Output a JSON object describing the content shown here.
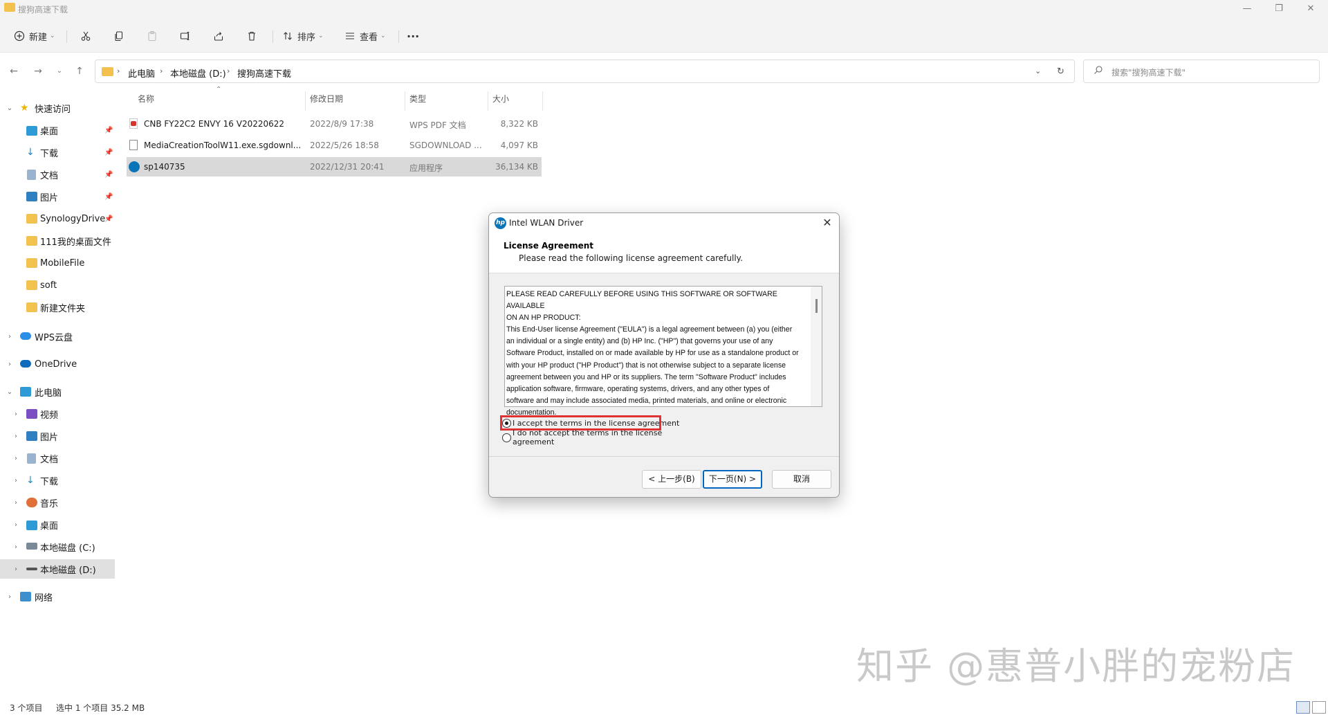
{
  "window": {
    "title": "搜狗高速下载",
    "controls": [
      "minimize-icon",
      "restore-icon",
      "close-icon"
    ]
  },
  "toolbar": {
    "new_label": "新建",
    "sort_label": "排序",
    "view_label": "查看",
    "more_label": "···"
  },
  "address": {
    "crumbs": [
      "此电脑",
      "本地磁盘 (D:)",
      "搜狗高速下载"
    ],
    "search_placeholder": "搜索\"搜狗高速下载\""
  },
  "sidebar": {
    "quick_access": "快速访问",
    "quick_items": [
      "桌面",
      "下载",
      "文档",
      "图片",
      "SynologyDrive",
      "111我的桌面文件",
      "MobileFile",
      "soft",
      "新建文件夹"
    ],
    "wps": "WPS云盘",
    "onedrive": "OneDrive",
    "this_pc": "此电脑",
    "pc_items": [
      "视频",
      "图片",
      "文档",
      "下载",
      "音乐",
      "桌面",
      "本地磁盘 (C:)",
      "本地磁盘 (D:)"
    ],
    "network": "网络"
  },
  "files": {
    "headers": [
      "名称",
      "修改日期",
      "类型",
      "大小"
    ],
    "rows": [
      {
        "name": "CNB FY22C2  ENVY 16 V20220622",
        "date": "2022/8/9 17:38",
        "type": "WPS PDF 文档",
        "size": "8,322 KB",
        "icon": "pdf-icon"
      },
      {
        "name": "MediaCreationToolW11.exe.sgdownl...",
        "date": "2022/5/26 18:58",
        "type": "SGDOWNLOAD ...",
        "size": "4,097 KB",
        "icon": "file-icon"
      },
      {
        "name": "sp140735",
        "date": "2022/12/31 20:41",
        "type": "应用程序",
        "size": "36,134 KB",
        "icon": "hp-icon"
      }
    ]
  },
  "dialog": {
    "title": "Intel WLAN Driver",
    "heading": "License Agreement",
    "subheading": "Please read the following license agreement carefully.",
    "eula_lines": [
      "PLEASE READ CAREFULLY BEFORE USING THIS SOFTWARE OR SOFTWARE AVAILABLE",
      "ON AN HP PRODUCT:",
      "This End-User license Agreement (\"EULA\") is a legal agreement between (a) you (either",
      "an individual or a single entity) and (b) HP Inc. (\"HP\") that governs your use of any",
      "Software Product, installed on or made available by HP for use as a standalone product or",
      "with your HP product (\"HP Product\") that is not otherwise subject to a separate license",
      "agreement between you and HP or its suppliers. The term \"Software Product\" includes",
      "application software, firmware, operating systems, drivers, and any other types of",
      "software and may include associated media, printed materials, and online or electronic",
      "documentation."
    ],
    "accept_label": "I accept the terms in the license agreement",
    "decline_label": "I do not accept the terms in the license agreement",
    "back_label": "< 上一步(B)",
    "next_label": "下一页(N) >",
    "cancel_label": "取消"
  },
  "status": {
    "count": "3 个项目",
    "selected": "选中 1 个项目  35.2 MB"
  },
  "watermark": "知乎 @惠普小胖的宠粉店",
  "colors": {
    "selection": "#d9d9d9",
    "highlight_box": "#e03232",
    "primary_button_border": "#0067c0",
    "folder": "#f2c14e"
  }
}
